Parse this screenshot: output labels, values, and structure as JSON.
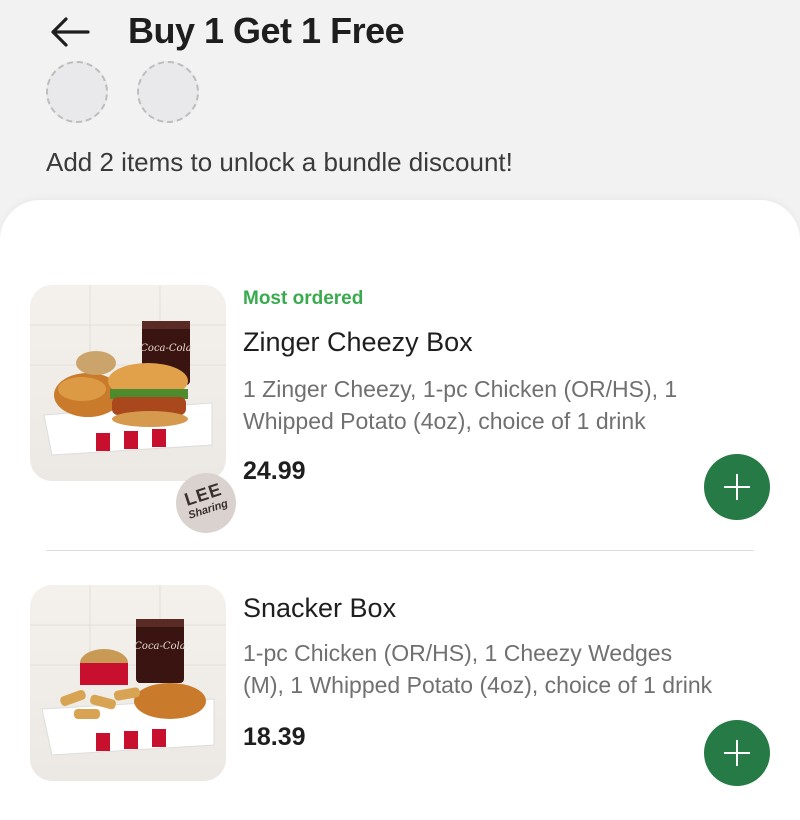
{
  "header": {
    "back_icon": "arrow-left-icon",
    "title": "Buy 1 Get 1 Free",
    "slots_count": 2,
    "hint": "Add 2 items to unlock a bundle discount!"
  },
  "items": [
    {
      "badge": "Most ordered",
      "name": "Zinger Cheezy Box",
      "description": "1 Zinger Cheezy, 1-pc Chicken (OR/HS), 1 Whipped Potato (4oz), choice of 1 drink",
      "price": "24.99",
      "add_icon": "plus-icon",
      "stamp": {
        "line1": "LEE",
        "line2": "Sharing"
      }
    },
    {
      "name": "Snacker Box",
      "description": "1-pc Chicken (OR/HS), 1 Cheezy Wedges (M), 1 Whipped Potato (4oz), choice of 1 drink",
      "price": "18.39",
      "add_icon": "plus-icon"
    }
  ],
  "colors": {
    "accent_green": "#257a45",
    "badge_green": "#3aaa4e",
    "background": "#f2f2f2"
  }
}
